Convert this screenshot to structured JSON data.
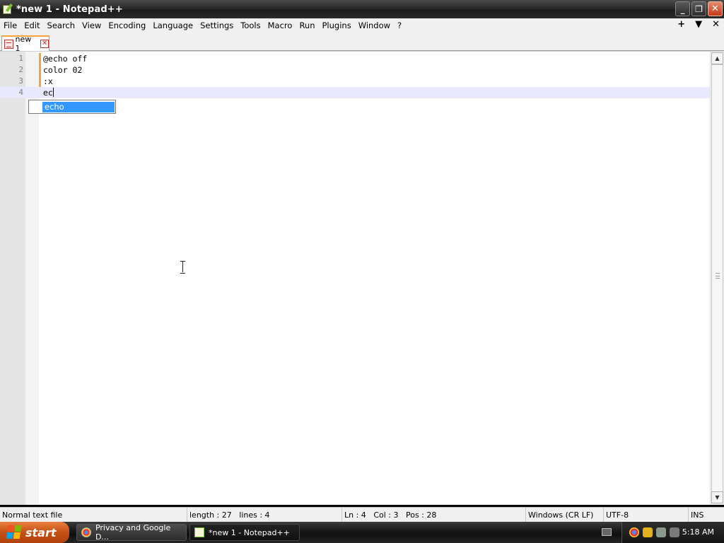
{
  "window": {
    "title": "*new 1 - Notepad++",
    "controls": {
      "minimize": "_",
      "restore": "❐",
      "close": "✕"
    }
  },
  "menubar": {
    "items": [
      "File",
      "Edit",
      "Search",
      "View",
      "Encoding",
      "Language",
      "Settings",
      "Tools",
      "Macro",
      "Run",
      "Plugins",
      "Window",
      "?"
    ],
    "right": {
      "add": "+",
      "dropdown": "▼",
      "close": "✕"
    }
  },
  "tabs": [
    {
      "label": "new 1",
      "icon": "unsaved-file-icon",
      "close": "✕"
    }
  ],
  "editor": {
    "lines": [
      {
        "number": "1",
        "text": "@echo off"
      },
      {
        "number": "2",
        "text": "color 02"
      },
      {
        "number": "3",
        "text": ":x"
      },
      {
        "number": "4",
        "text": "ec"
      }
    ],
    "current_line": 4,
    "autocomplete": {
      "items": [
        "echo"
      ],
      "selected": "echo"
    }
  },
  "statusbar": {
    "file_type": "Normal text file",
    "length": "length : 27",
    "lines": "lines : 4",
    "ln": "Ln : 4",
    "col": "Col : 3",
    "pos": "Pos : 28",
    "eol": "Windows (CR LF)",
    "encoding": "UTF-8",
    "mode": "INS"
  },
  "taskbar": {
    "start_label": "start",
    "tasks": [
      {
        "label": "Privacy and Google D...",
        "icon": "chrome-icon",
        "active": false
      },
      {
        "label": "*new 1 - Notepad++",
        "icon": "notepadpp-icon",
        "active": true
      }
    ],
    "clock": "5:18 AM"
  },
  "colors": {
    "accent_orange": "#f7a33b",
    "selection_blue": "#3399ff",
    "current_line": "#e8e8ff"
  }
}
